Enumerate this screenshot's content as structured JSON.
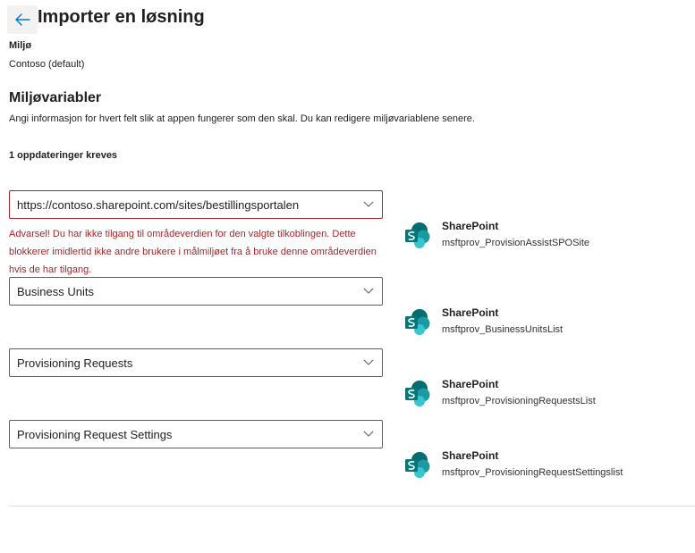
{
  "header": {
    "back_icon": "arrow-left-icon",
    "title": "Importer en løsning"
  },
  "environment": {
    "label": "Miljø",
    "value": "Contoso (default)"
  },
  "section": {
    "title": "Miljøvariabler",
    "description": "Angi informasjon for hvert felt slik at appen fungerer som den skal. Du kan redigere miljøvariablene senere.",
    "updates_required": "1 oppdateringer kreves"
  },
  "variables": [
    {
      "value": "https://contoso.sharepoint.com/sites/bestillingsportalen",
      "has_error": true,
      "error_text": "Advarsel! Du har ikke tilgang til områdeverdien for den valgte tilkoblingen. Dette blokkerer imidlertid ikke andre brukere i målmiljøet fra å bruke denne områdeverdien hvis de har tilgang.",
      "connection_name": "SharePoint",
      "connection_id": "msftprov_ProvisionAssistSPOSite"
    },
    {
      "value": "Business Units",
      "has_error": false,
      "connection_name": "SharePoint",
      "connection_id": "msftprov_BusinessUnitsList"
    },
    {
      "value": "Provisioning Requests",
      "has_error": false,
      "connection_name": "SharePoint",
      "connection_id": "msftprov_ProvisioningRequestsList"
    },
    {
      "value": "Provisioning Request Settings",
      "has_error": false,
      "connection_name": "SharePoint",
      "connection_id": "msftprov_ProvisioningRequestSettingslist"
    }
  ],
  "icons": {
    "dropdown": "chevron-down-icon",
    "connector": "sharepoint-icon"
  },
  "colors": {
    "accent": "#0078d4",
    "error": "#a4262c",
    "sharepoint_dark": "#036c70",
    "sharepoint_mid": "#1a9ba1",
    "sharepoint_light": "#37c6d0"
  }
}
